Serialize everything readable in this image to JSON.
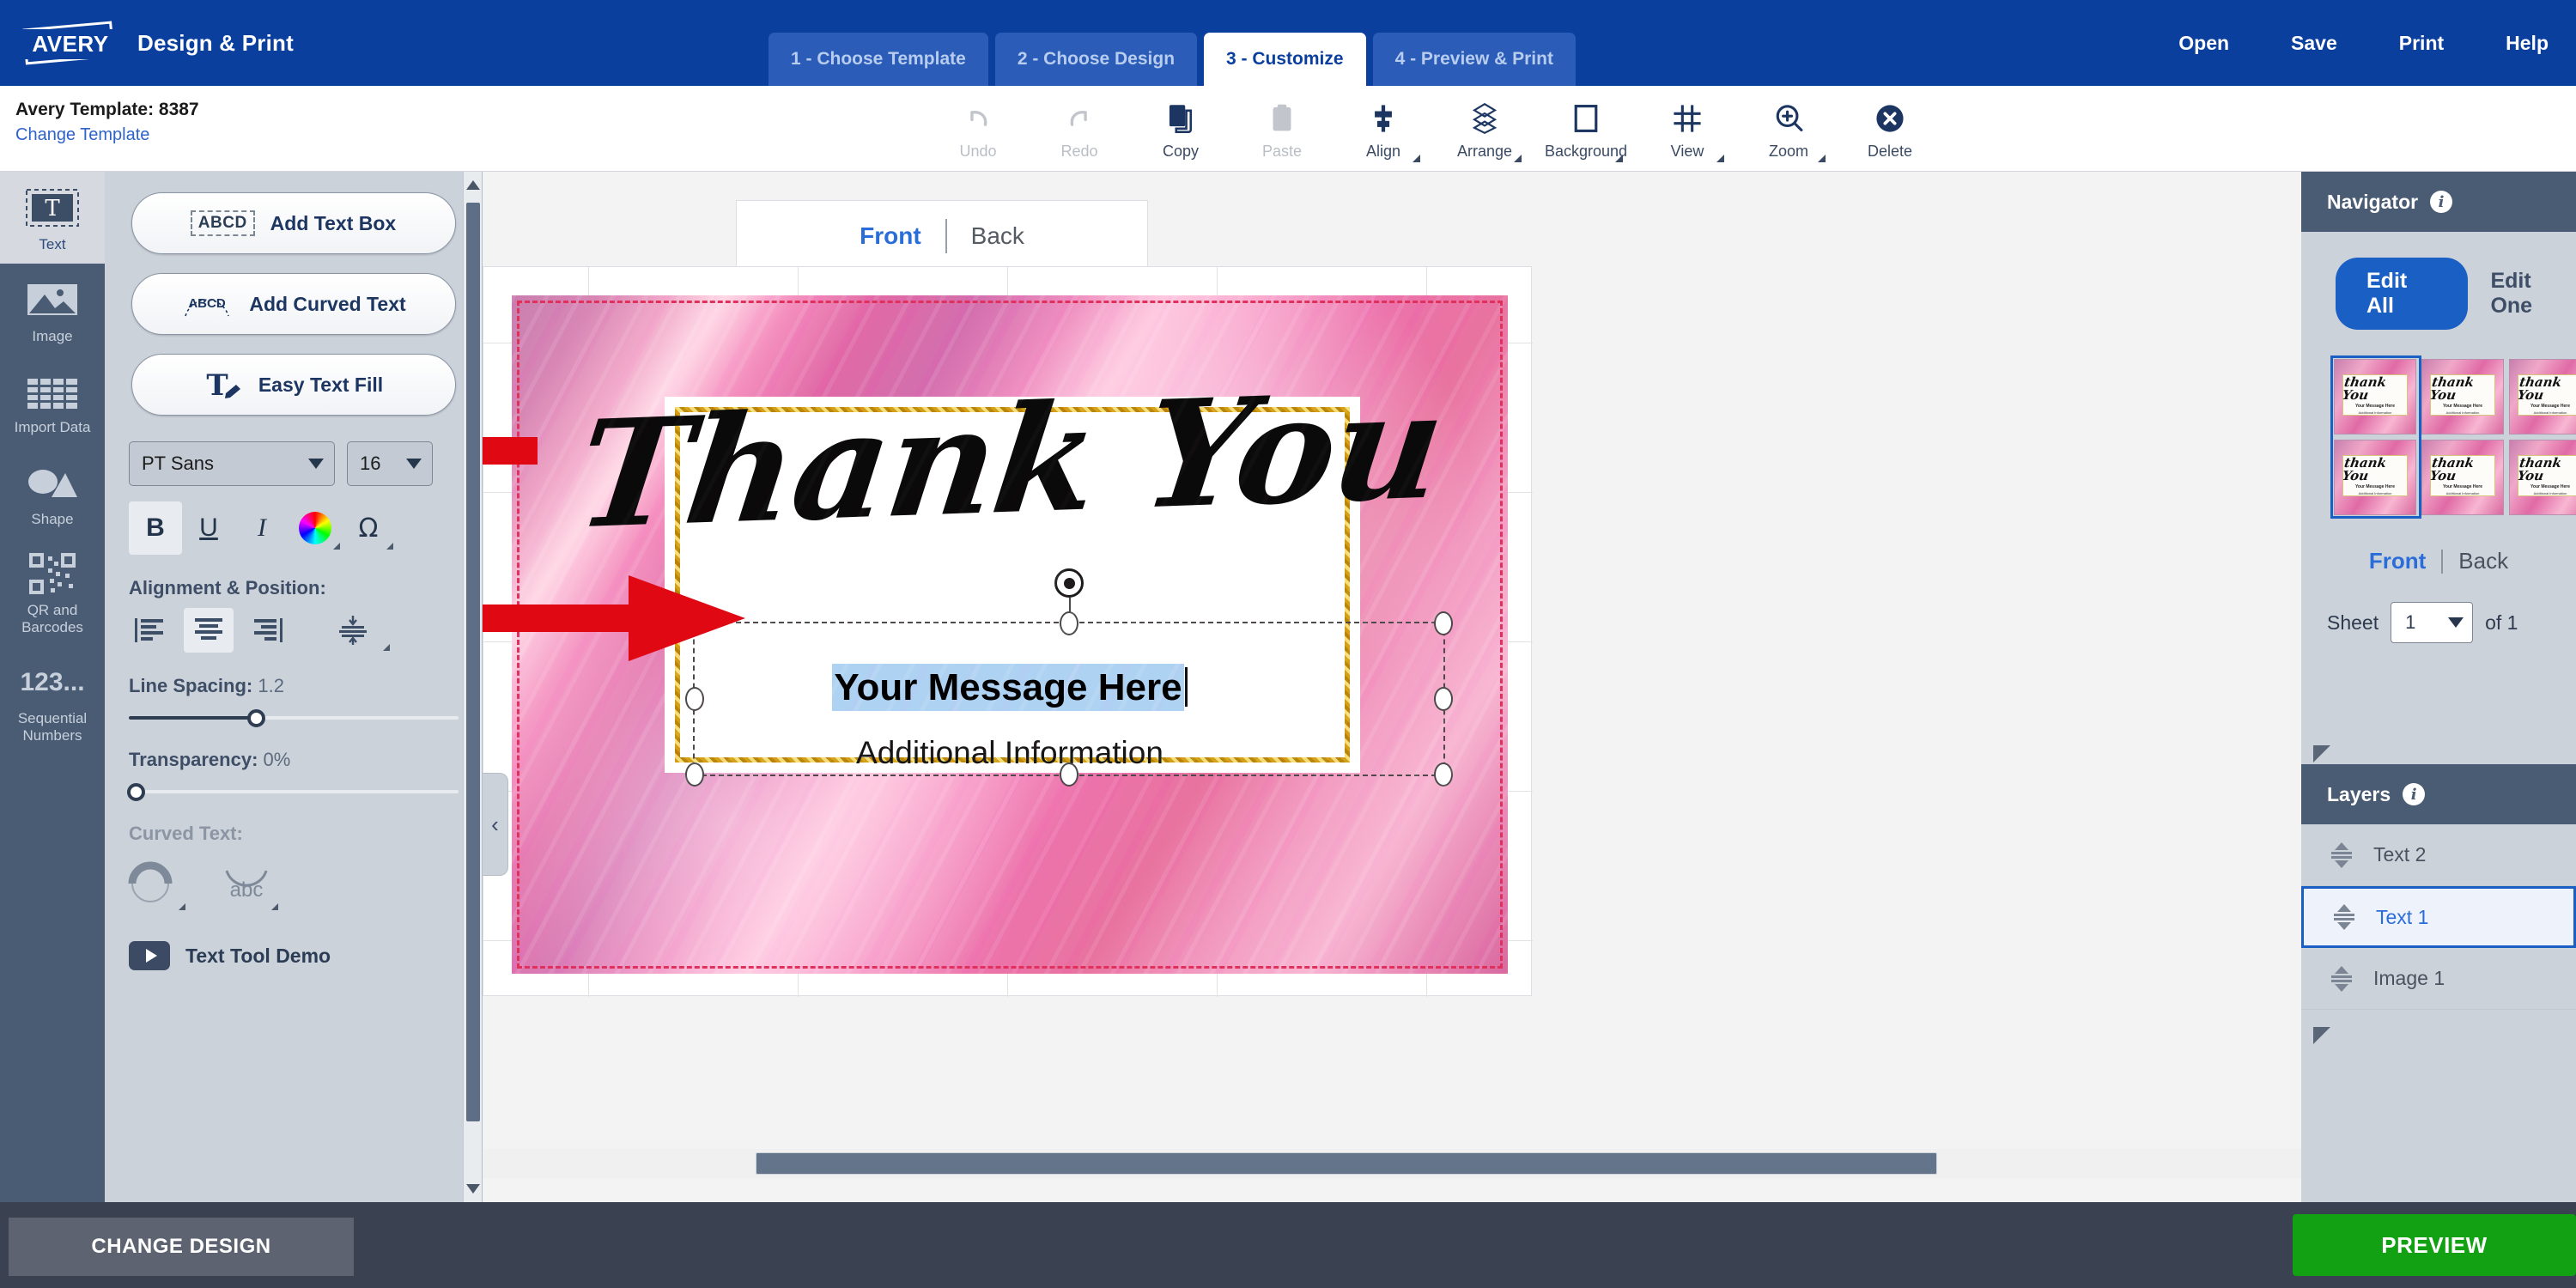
{
  "app": {
    "brand": "AVERY",
    "title": "Design & Print"
  },
  "steps": [
    {
      "label": "1 - Choose Template",
      "active": false
    },
    {
      "label": "2 - Choose Design",
      "active": false
    },
    {
      "label": "3 - Customize",
      "active": true
    },
    {
      "label": "4 - Preview & Print",
      "active": false
    }
  ],
  "topmenu": [
    {
      "label": "Open"
    },
    {
      "label": "Save"
    },
    {
      "label": "Print"
    },
    {
      "label": "Help"
    }
  ],
  "template": {
    "name": "Avery Template: 8387",
    "change_link": "Change Template"
  },
  "toolbar": [
    {
      "label": "Undo",
      "icon": "undo-icon",
      "disabled": true,
      "caret": false
    },
    {
      "label": "Redo",
      "icon": "redo-icon",
      "disabled": true,
      "caret": false
    },
    {
      "label": "Copy",
      "icon": "copy-icon",
      "disabled": false,
      "caret": false
    },
    {
      "label": "Paste",
      "icon": "paste-icon",
      "disabled": true,
      "caret": false
    },
    {
      "label": "Align",
      "icon": "align-icon",
      "disabled": false,
      "caret": true
    },
    {
      "label": "Arrange",
      "icon": "arrange-icon",
      "disabled": false,
      "caret": true
    },
    {
      "label": "Background",
      "icon": "background-icon",
      "disabled": false,
      "caret": true
    },
    {
      "label": "View",
      "icon": "view-grid-icon",
      "disabled": false,
      "caret": true
    },
    {
      "label": "Zoom",
      "icon": "zoom-icon",
      "disabled": false,
      "caret": true
    },
    {
      "label": "Delete",
      "icon": "delete-icon",
      "disabled": false,
      "caret": false
    }
  ],
  "rail": [
    {
      "label": "Text",
      "icon": "text-tool-icon",
      "active": true
    },
    {
      "label": "Image",
      "icon": "image-tool-icon",
      "active": false
    },
    {
      "label": "Import Data",
      "icon": "import-data-icon",
      "active": false
    },
    {
      "label": "Shape",
      "icon": "shape-tool-icon",
      "active": false
    },
    {
      "label": "QR and Barcodes",
      "icon": "qr-barcode-icon",
      "active": false
    },
    {
      "label": "Sequential Numbers",
      "icon": "sequential-numbers-icon",
      "active": false
    }
  ],
  "text_panel": {
    "add_text_box": "Add Text Box",
    "add_text_box_icon_label": "ABCD",
    "add_curved_text": "Add Curved Text",
    "easy_text_fill": "Easy Text Fill",
    "font_family": "PT Sans",
    "font_size": "16",
    "bold": "B",
    "underline": "U",
    "italic": "I",
    "alignment_label": "Alignment & Position:",
    "line_spacing_label": "Line Spacing:",
    "line_spacing_value": "1.2",
    "transparency_label": "Transparency:",
    "transparency_value": "0%",
    "curved_text_label": "Curved Text:",
    "demo_label": "Text Tool Demo"
  },
  "canvas": {
    "side_tabs": [
      {
        "label": "Front",
        "active": true
      },
      {
        "label": "Back",
        "active": false
      }
    ],
    "card": {
      "headline": "Thank You",
      "message": "Your Message Here",
      "additional": "Additional Information"
    }
  },
  "navigator": {
    "title": "Navigator",
    "edit_all": "Edit All",
    "edit_one": "Edit One",
    "side_tabs": [
      {
        "label": "Front",
        "active": true
      },
      {
        "label": "Back",
        "active": false
      }
    ],
    "sheet_label": "Sheet",
    "sheet_value": "1",
    "sheet_of": "of 1",
    "thumb_headline": "thank You",
    "thumb_message": "Your Message Here",
    "thumb_additional": "Additional Information"
  },
  "layers": {
    "title": "Layers",
    "items": [
      {
        "label": "Text 2",
        "selected": false
      },
      {
        "label": "Text 1",
        "selected": true
      },
      {
        "label": "Image 1",
        "selected": false
      }
    ]
  },
  "footer": {
    "change_design": "CHANGE DESIGN",
    "preview": "PREVIEW"
  },
  "colors": {
    "brand_blue": "#0b3f9e",
    "accent_blue": "#2a6dd9",
    "panel_gray": "#ccd2da",
    "rail_dark": "#4a5c74",
    "green": "#12a112",
    "arrow_red": "#e00812",
    "selection_highlight": "#aed2f2"
  }
}
